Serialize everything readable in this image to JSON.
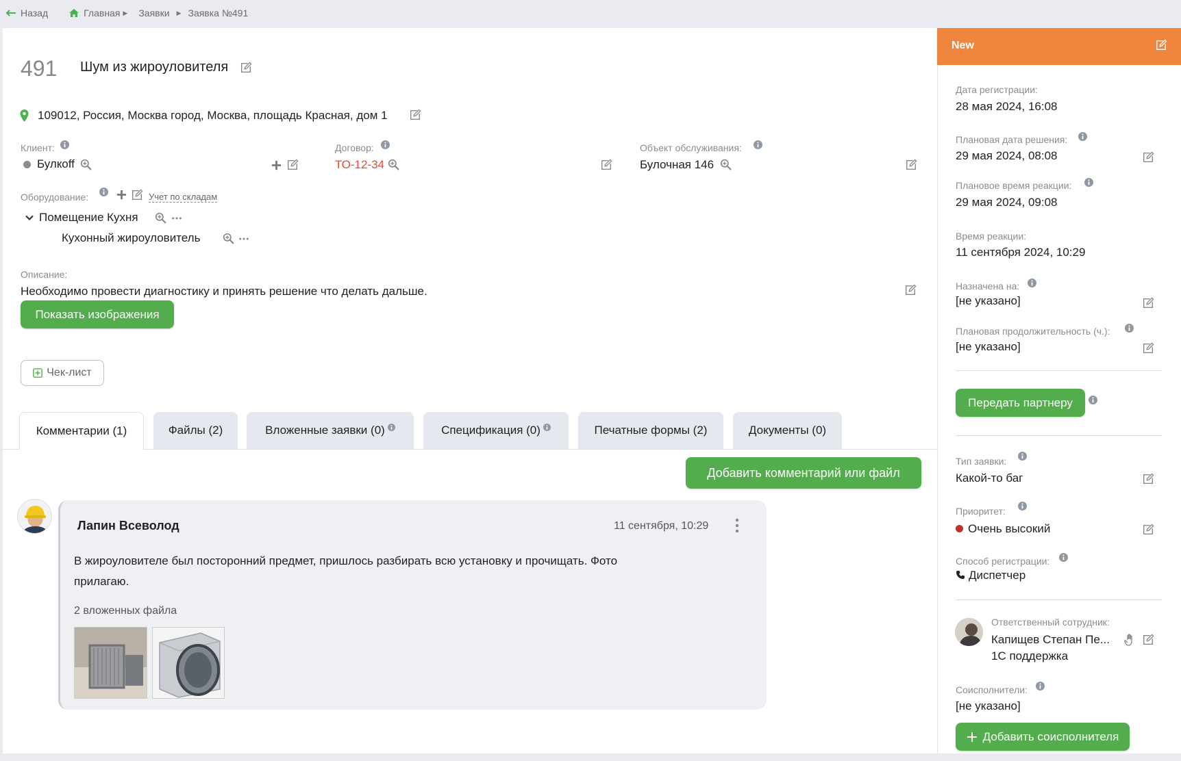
{
  "breadcrumb": {
    "back": "Назад",
    "home": "Главная",
    "requests": "Заявки",
    "current": "Заявка №491"
  },
  "ticket": {
    "number": "491",
    "title": "Шум из жироуловителя",
    "address": "109012, Россия, Москва город, Москва, площадь Красная, дом 1",
    "client_label": "Клиент:",
    "client_value": "Булкoff",
    "contract_label": "Договор:",
    "contract_value": "ТО-12-34",
    "object_label": "Объект обслуживания:",
    "object_value": "Булочная 146",
    "equipment_label": "Оборудование:",
    "warehouse_link": "Учет по складам",
    "equipment_items": [
      "Помещение Кухня",
      "Кухонный жироуловитель"
    ],
    "description_label": "Описание:",
    "description_text": "Необходимо провести диагностику и принять решение что делать дальше.",
    "show_images_button": "Показать изображения",
    "checklist_button": "Чек-лист"
  },
  "tabs": [
    "Комментарии (1)",
    "Файлы (2)",
    "Вложенные заявки (0)",
    "Спецификация (0)",
    "Печатные формы (2)",
    "Документы (0)"
  ],
  "add_comment_button": "Добавить комментарий или файл",
  "comment": {
    "author": "Лапин Всеволод",
    "time": "11 сентября, 10:29",
    "text_line1": "В жироуловителе был посторонний предмет, пришлось разбирать всю установку и прочищать. Фото",
    "text_line2": "прилагаю.",
    "attachments_label": "2 вложенных файла"
  },
  "sidebar": {
    "status": "New",
    "registration_date_label": "Дата регистрации:",
    "registration_date": "28 мая 2024, 16:08",
    "planned_solution_label": "Плановая дата решения:",
    "planned_solution": "29 мая 2024, 08:08",
    "planned_reaction_label": "Плановое время реакции:",
    "planned_reaction": "29 мая 2024, 09:08",
    "reaction_label": "Время реакции:",
    "reaction": "11 сентября 2024, 10:29",
    "assigned_label": "Назначена на:",
    "assigned": "[не указано]",
    "duration_label": "Плановая продолжительность (ч.):",
    "duration": "[не указано]",
    "partner_button": "Передать партнеру",
    "type_label": "Тип заявки:",
    "type": "Какой-то баг",
    "priority_label": "Приоритет:",
    "priority": "Очень высокий",
    "reg_method_label": "Способ регистрации:",
    "reg_method": "Диспетчер",
    "responsible_label": "Ответственный сотрудник:",
    "responsible_name": "Капищев Степан Пе...",
    "responsible_dept": "1С поддержка",
    "coexecutors_label": "Соисполнители:",
    "coexecutors": "[не указано]",
    "add_coexecutor_button": "Добавить соисполнителя"
  },
  "colors": {
    "accent_green": "#53ad4c",
    "status_orange": "#f0863e",
    "priority_red": "#c0312b",
    "contract_red": "#e04e3a"
  }
}
